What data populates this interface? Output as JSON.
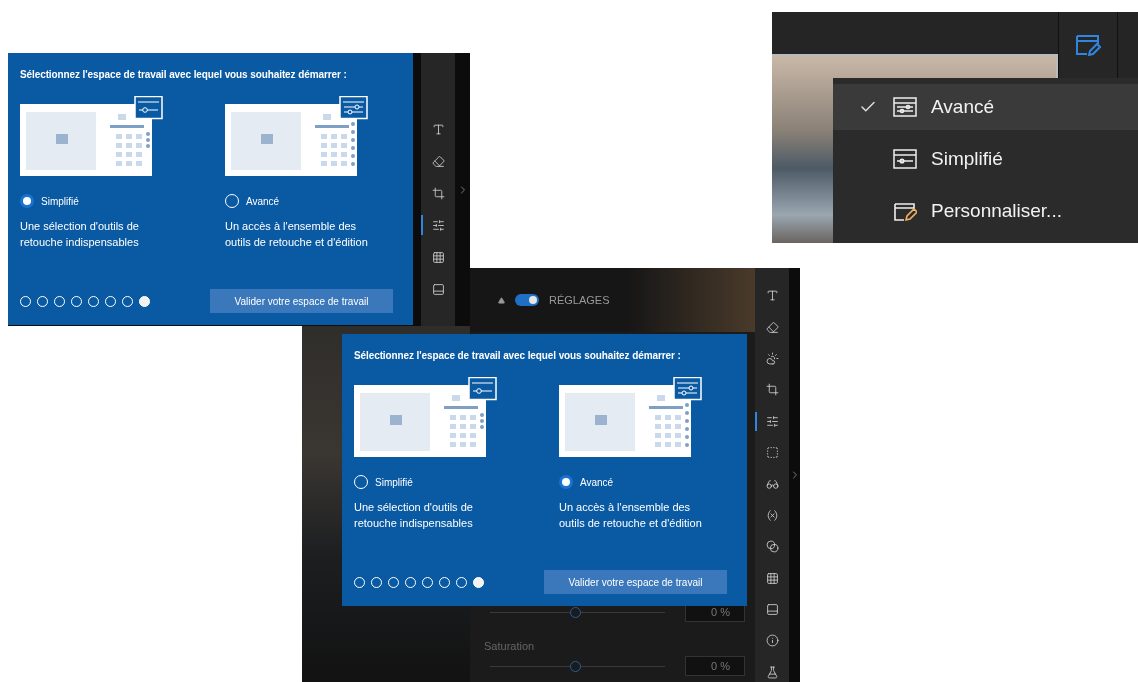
{
  "dialogs": [
    {
      "title": "Sélectionnez l'espace de travail avec lequel vous souhaitez démarrer :",
      "options": [
        {
          "kind": "simple",
          "label": "Simplifié",
          "description": "Une sélection d'outils de\nretouche indispensables",
          "selected": true
        },
        {
          "kind": "advanced",
          "label": "Avancé",
          "description": "Un accès à l'ensemble des\noutils de retouche et d'édition",
          "selected": false
        }
      ],
      "pager": [
        {
          "selected": false
        },
        {
          "selected": false
        },
        {
          "selected": false
        },
        {
          "selected": false
        },
        {
          "selected": false
        },
        {
          "selected": false
        },
        {
          "selected": false
        },
        {
          "selected": true
        }
      ],
      "button": "Valider votre espace de travail"
    },
    {
      "title": "Sélectionnez l'espace de travail avec lequel vous souhaitez démarrer :",
      "options": [
        {
          "kind": "simple",
          "label": "Simplifié",
          "description": "Une sélection d'outils de\nretouche indispensables",
          "selected": false
        },
        {
          "kind": "advanced",
          "label": "Avancé",
          "description": "Un accès à l'ensemble des\noutils de retouche et d'édition",
          "selected": true
        }
      ],
      "pager": [
        {
          "selected": false
        },
        {
          "selected": false
        },
        {
          "selected": false
        },
        {
          "selected": false
        },
        {
          "selected": false
        },
        {
          "selected": false
        },
        {
          "selected": false
        },
        {
          "selected": true
        }
      ],
      "button": "Valider votre espace de travail"
    }
  ],
  "toolbars": [
    [
      {
        "kind": "text",
        "selected": false
      },
      {
        "kind": "eraser",
        "selected": false
      },
      {
        "kind": "crop",
        "selected": false
      },
      {
        "kind": "adjust",
        "selected": true
      },
      {
        "kind": "texture",
        "selected": false
      },
      {
        "kind": "frame",
        "selected": false
      }
    ],
    [
      {
        "kind": "text",
        "selected": false
      },
      {
        "kind": "eraser",
        "selected": false
      },
      {
        "kind": "weather",
        "selected": false
      },
      {
        "kind": "crop",
        "selected": false
      },
      {
        "kind": "adjust",
        "selected": true
      },
      {
        "kind": "selection",
        "selected": false
      },
      {
        "kind": "glasses",
        "selected": false
      },
      {
        "kind": "effects",
        "selected": false
      },
      {
        "kind": "blend",
        "selected": false
      },
      {
        "kind": "texture",
        "selected": false
      },
      {
        "kind": "frame",
        "selected": false
      },
      {
        "kind": "info",
        "selected": false
      },
      {
        "kind": "lab",
        "selected": false
      }
    ]
  ],
  "adjust_panel": {
    "section": "RÉGLAGES",
    "on": true,
    "sliders": [
      {
        "level": 0.49,
        "reading": "0 %"
      },
      {
        "label": "Saturation",
        "level": 0.49,
        "reading": "0 %"
      }
    ]
  },
  "workspace_menu": [
    {
      "kind": "advanced",
      "label": "Avancé",
      "checked": true
    },
    {
      "kind": "simple",
      "label": "Simplifié",
      "checked": false
    },
    {
      "kind": "custom",
      "label": "Personnaliser...",
      "checked": false
    }
  ]
}
